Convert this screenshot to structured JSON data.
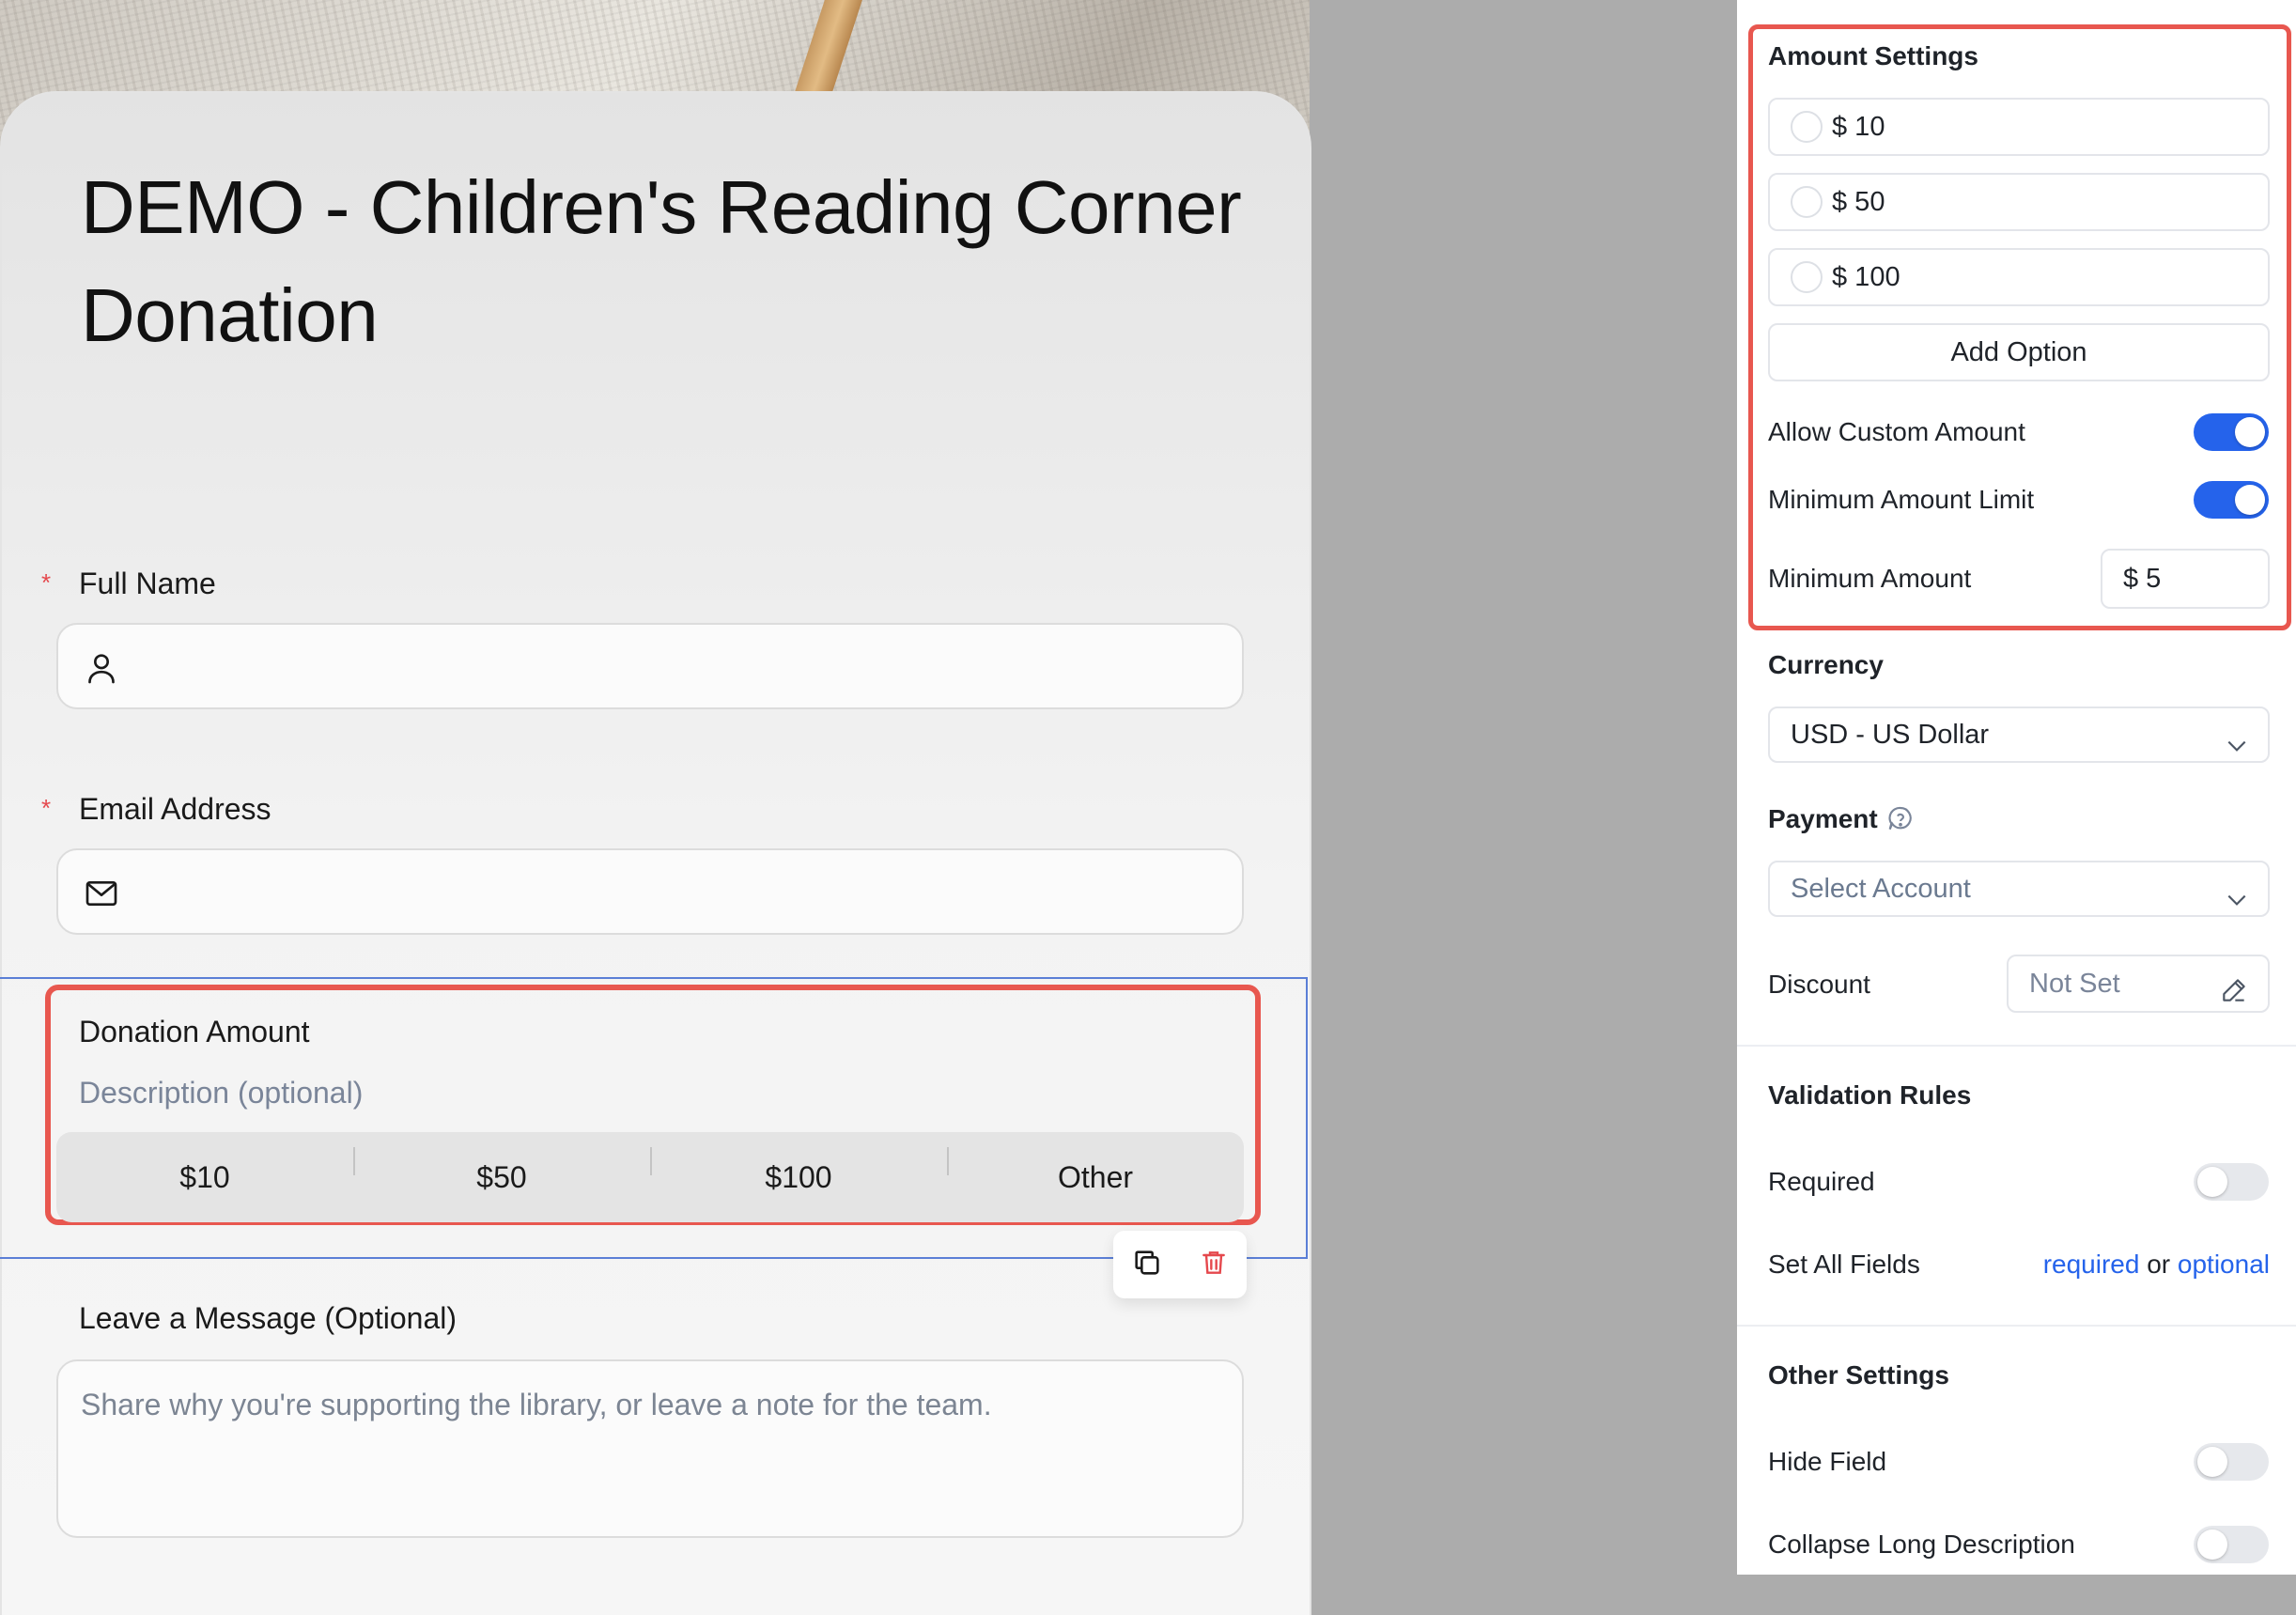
{
  "form": {
    "title": "DEMO - Children's Reading Corner Donation",
    "full_name": {
      "label": "Full Name",
      "required_mark": "*"
    },
    "email": {
      "label": "Email Address",
      "required_mark": "*"
    },
    "donation": {
      "label": "Donation Amount",
      "description_placeholder": "Description (optional)",
      "options": [
        "$10",
        "$50",
        "$100",
        "Other"
      ]
    },
    "message": {
      "label": "Leave a Message (Optional)",
      "placeholder": "Share why you're supporting the library, or leave a note for the team."
    },
    "toolbar": {
      "copy_icon": "copy-icon",
      "delete_icon": "trash-icon"
    }
  },
  "settings": {
    "amount_settings": {
      "heading": "Amount Settings",
      "options": [
        "$ 10",
        "$ 50",
        "$ 100"
      ],
      "add_option_label": "Add Option",
      "allow_custom_amount": {
        "label": "Allow Custom Amount",
        "enabled": true
      },
      "minimum_amount_limit": {
        "label": "Minimum Amount Limit",
        "enabled": true
      },
      "minimum_amount": {
        "label": "Minimum Amount",
        "value": "$ 5"
      }
    },
    "currency": {
      "heading": "Currency",
      "value": "USD - US Dollar"
    },
    "payment": {
      "heading": "Payment",
      "placeholder": "Select Account",
      "help_icon": "question-icon"
    },
    "discount": {
      "label": "Discount",
      "value": "Not Set",
      "edit_icon": "pencil-icon"
    },
    "validation": {
      "heading": "Validation Rules",
      "required": {
        "label": "Required",
        "enabled": false
      },
      "set_all_fields": {
        "label": "Set All Fields",
        "required_link": "required",
        "or_text": "or",
        "optional_link": "optional"
      }
    },
    "other": {
      "heading": "Other Settings",
      "hide_field": {
        "label": "Hide Field",
        "enabled": false
      },
      "collapse_long_description": {
        "label": "Collapse Long Description",
        "enabled": false
      }
    }
  },
  "colors": {
    "accent": "#2563eb",
    "highlight": "#e8574f",
    "required": "#e5484d",
    "selection": "#5b7fd6"
  }
}
